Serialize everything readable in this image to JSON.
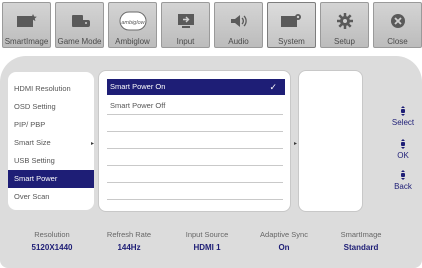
{
  "tabs": [
    {
      "label": "SmartImage",
      "icon": "smartimage-icon"
    },
    {
      "label": "Game Mode",
      "icon": "gamepad-icon"
    },
    {
      "label": "Ambiglow",
      "icon": "ambiglow-icon",
      "icon_text": "ambiglow"
    },
    {
      "label": "Input",
      "icon": "input-icon"
    },
    {
      "label": "Audio",
      "icon": "speaker-icon"
    },
    {
      "label": "System",
      "icon": "system-icon"
    },
    {
      "label": "Setup",
      "icon": "gear-icon"
    },
    {
      "label": "Close",
      "icon": "close-icon"
    }
  ],
  "menu": {
    "items": [
      "HDMI Resolution",
      "OSD Setting",
      "PIP/ PBP",
      "Smart Size",
      "USB Setting",
      "Smart Power",
      "Over Scan"
    ],
    "selected": "Smart Power"
  },
  "submenu": {
    "options": [
      "Smart Power On",
      "Smart Power Off"
    ],
    "selected": "Smart Power On",
    "check": "✓"
  },
  "controls": [
    {
      "label": "Select",
      "icon": "dpad-select-icon"
    },
    {
      "label": "OK",
      "icon": "dpad-ok-icon"
    },
    {
      "label": "Back",
      "icon": "dpad-back-icon"
    }
  ],
  "status": [
    {
      "label": "Resolution",
      "value": "5120X1440"
    },
    {
      "label": "Refresh Rate",
      "value": "144Hz"
    },
    {
      "label": "Input Source",
      "value": "HDMI 1"
    },
    {
      "label": "Adaptive Sync",
      "value": "On"
    },
    {
      "label": "SmartImage",
      "value": "Standard"
    }
  ],
  "colors": {
    "accent": "#1e1e76",
    "panel": "#dcdcdc",
    "tab": "#c8c8c8"
  }
}
